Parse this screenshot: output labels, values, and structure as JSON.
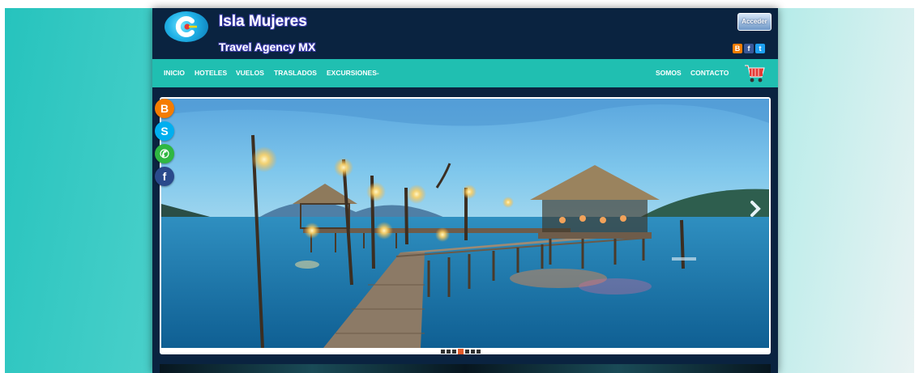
{
  "header": {
    "title": "Isla Mujeres",
    "subtitle": "Travel Agency MX",
    "login_label": "Acceder",
    "social": [
      {
        "icon": "blogger-icon",
        "glyph": "B"
      },
      {
        "icon": "facebook-icon",
        "glyph": "f"
      },
      {
        "icon": "twitter-icon",
        "glyph": "t"
      }
    ]
  },
  "nav": {
    "left": [
      "INICIO",
      "HOTELES",
      "VUELOS",
      "TRASLADOS",
      "EXCURSIONES-"
    ],
    "right": [
      "SOMOS",
      "CONTACTO"
    ],
    "cart_icon": "shopping-cart-icon"
  },
  "slider": {
    "image": "wooden-pier-with-lanterns-over-lagoon",
    "arrow_icon": "chevron-right-icon",
    "slide_count": 7,
    "active_slide": 4
  },
  "floating_social": [
    {
      "icon": "blogger-icon",
      "glyph": "B"
    },
    {
      "icon": "skype-icon",
      "glyph": "S"
    },
    {
      "icon": "whatsapp-icon",
      "glyph": "✆"
    },
    {
      "icon": "facebook-icon",
      "glyph": "f"
    }
  ],
  "colors": {
    "page_bg": "#0a2340",
    "nav_bg": "#20bfb1",
    "accent": "#e15a2a"
  }
}
